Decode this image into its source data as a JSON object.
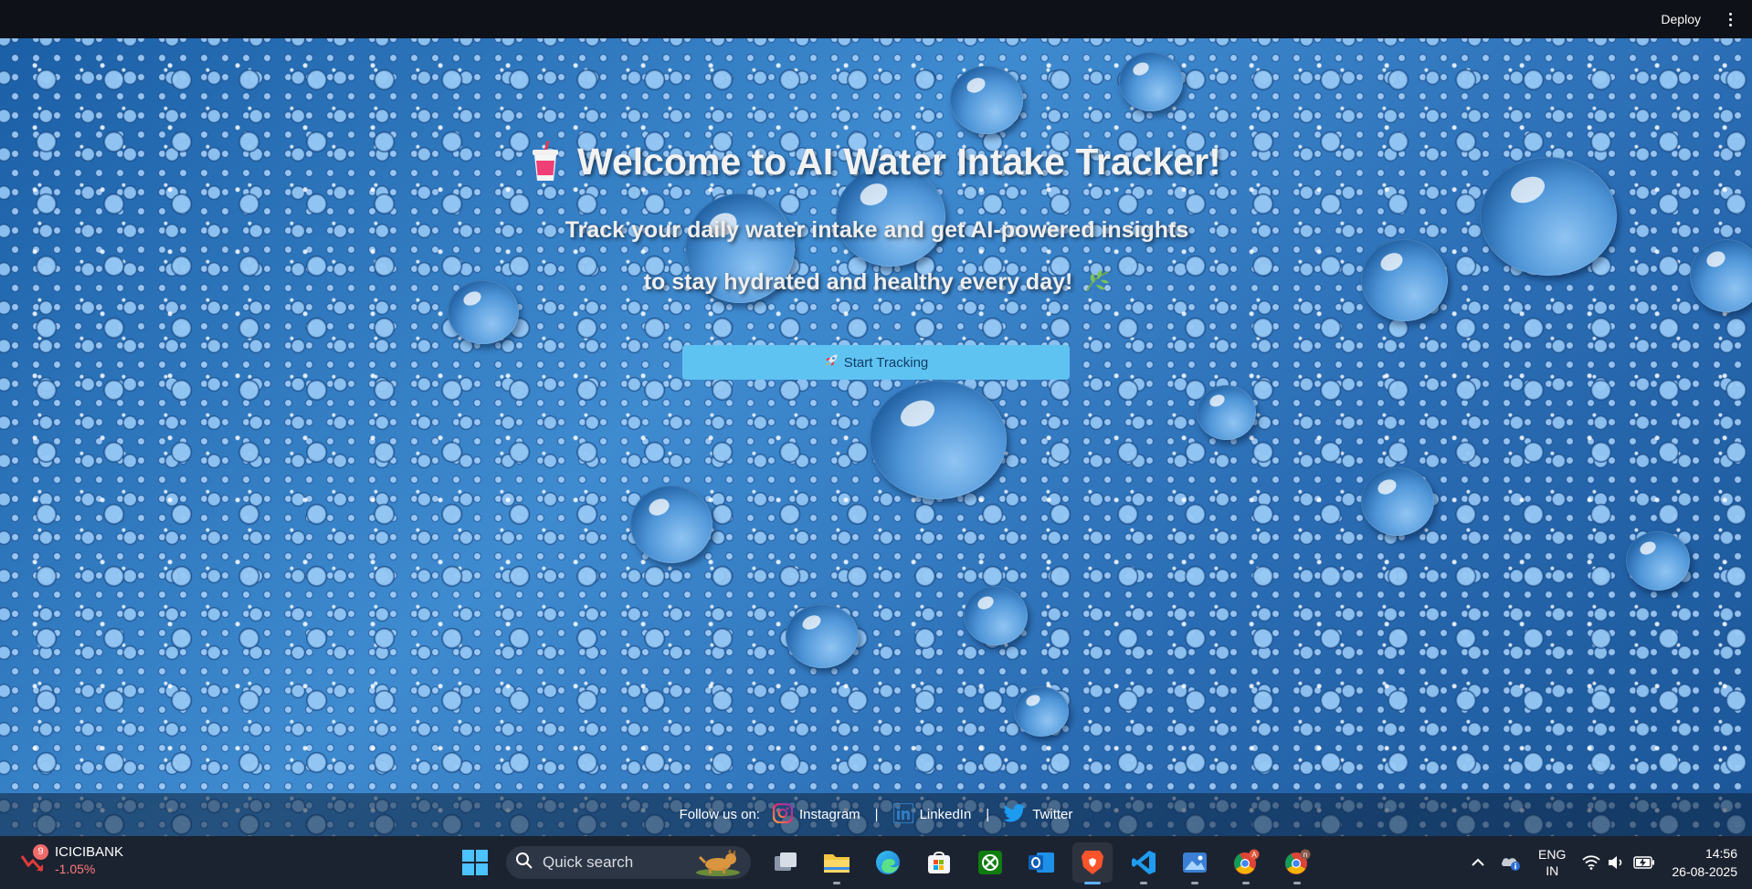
{
  "topbar": {
    "deploy_label": "Deploy",
    "menu_icon": "kebab-menu-icon"
  },
  "hero": {
    "title": "Welcome to AI Water Intake Tracker!",
    "title_icon": "cup-with-straw-icon",
    "subtitle_line1": "Track your daily water intake and get AI-powered insights",
    "subtitle_line2": "to stay hydrated and healthy every day!",
    "subtitle_icon": "leaf-icon",
    "start_button_label": "Start Tracking",
    "start_button_icon": "rocket-icon",
    "start_button_color": "#5fc3f2"
  },
  "footer": {
    "follow_label": "Follow us on:",
    "links": [
      {
        "label": "Instagram",
        "icon": "instagram-icon"
      },
      {
        "label": "LinkedIn",
        "icon": "linkedin-icon"
      },
      {
        "label": "Twitter",
        "icon": "twitter-icon"
      }
    ],
    "separator": "|"
  },
  "taskbar": {
    "stock": {
      "name": "ICICIBANK",
      "change": "-1.05%",
      "badge": "9"
    },
    "search_placeholder": "Quick search",
    "apps": [
      {
        "name": "task-view-icon"
      },
      {
        "name": "file-explorer-icon"
      },
      {
        "name": "edge-browser-icon"
      },
      {
        "name": "microsoft-store-icon"
      },
      {
        "name": "xbox-icon"
      },
      {
        "name": "outlook-icon"
      },
      {
        "name": "brave-browser-icon",
        "active": true
      },
      {
        "name": "vscode-icon"
      },
      {
        "name": "photos-icon"
      },
      {
        "name": "chrome-profile-a-icon",
        "badge": "A"
      },
      {
        "name": "chrome-profile-n-icon",
        "badge": "n"
      }
    ],
    "language": {
      "line1": "ENG",
      "line2": "IN"
    },
    "time": "14:56",
    "date": "26-08-2025"
  }
}
